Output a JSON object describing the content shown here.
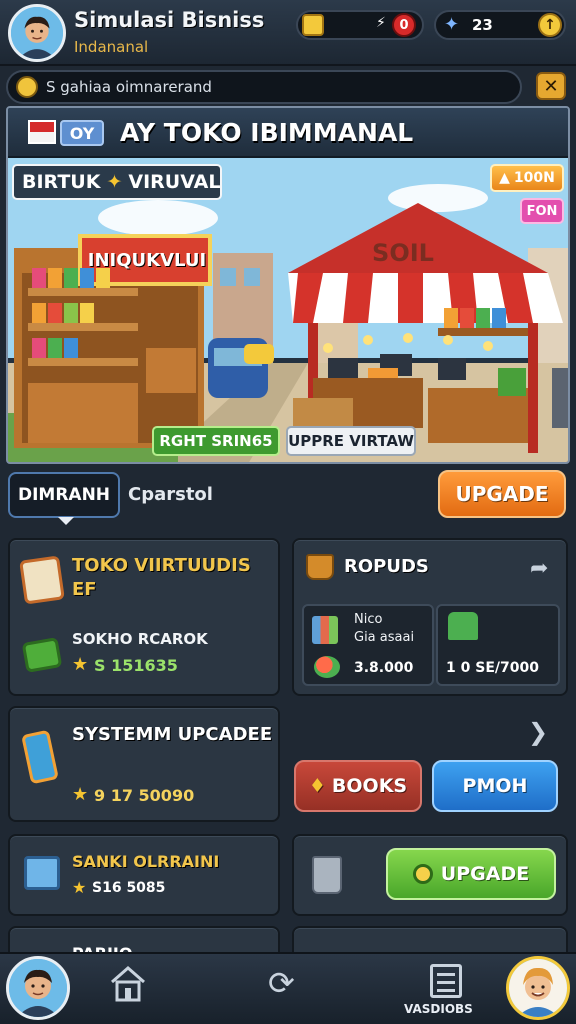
{
  "header": {
    "title": "Simulasi Bisniss",
    "subtitle": "Indananal",
    "stat_coins": "0",
    "stat_gems": "23"
  },
  "news": {
    "text": "S gahiaa oimnarerand"
  },
  "banner": {
    "title": "AY TOKO IBIMMANAL",
    "flag_label": "OY",
    "tag_left": "BIRTUK",
    "tag_left_2": "VIRUVAL",
    "badge_value": "100N",
    "badge_pink": "FON",
    "store_sign": "INIQUKVLUI",
    "stall_sign": "SOIL",
    "chip_green": "RGHT SRIN65",
    "chip_white": "UPPRE VIRTAW"
  },
  "tabs": {
    "active": "DIMRANH",
    "second": "Cparstol"
  },
  "actions": {
    "upgrade_top": "UPGADE",
    "books": "BOOKS",
    "pmoh": "PMOH",
    "upgrade_bottom": "UPGADE"
  },
  "cards": {
    "toko": {
      "title": "TOKO VIIRTUUDIS EF",
      "label": "SOKHO RCAROK",
      "value": "S 151635"
    },
    "ropuds": {
      "title": "ROPUDS",
      "item1_name": "Nico",
      "item1_sub": "Gia asaai",
      "item1_value": "3.8.000",
      "item2_value": "1 0 SE/7000"
    },
    "system": {
      "title": "SYSTEMM UPCADEE",
      "value": "9 17 50090"
    },
    "sank": {
      "title": "SANKI OLRRAINI",
      "value": "S16 5085"
    },
    "partial": {
      "title": "PARIIO"
    }
  },
  "nav": {
    "label": "VASDIOBS"
  },
  "icons": [
    "avatar-icon",
    "coin-icon",
    "badge-icon",
    "bolt-icon",
    "info-icon",
    "globe-icon",
    "close-icon",
    "home-icon",
    "refresh-icon",
    "document-icon",
    "profile-icon",
    "share-icon",
    "arrow-right-icon",
    "trash-icon",
    "book-icon",
    "star-icon"
  ],
  "colors": {
    "accent_orange": "#e97c1f",
    "gold": "#f2c64c",
    "green": "#5bbf36",
    "blue": "#2d8ae0",
    "background": "#1f2833"
  }
}
